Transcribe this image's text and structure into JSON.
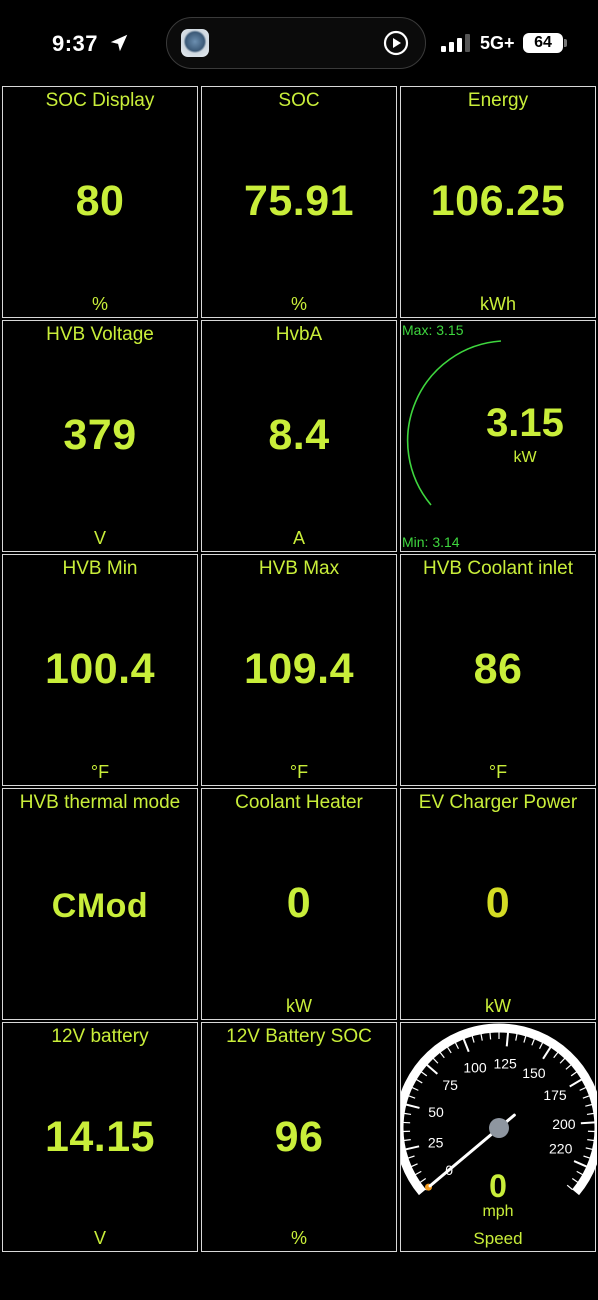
{
  "status": {
    "time": "9:37",
    "network": "5G+",
    "battery": "64"
  },
  "tiles": [
    {
      "title": "SOC Display",
      "value": "80",
      "unit": "%"
    },
    {
      "title": "SOC",
      "value": "75.91",
      "unit": "%"
    },
    {
      "title": "Energy",
      "value": "106.25",
      "unit": "kWh"
    },
    {
      "title": "HVB Voltage",
      "value": "379",
      "unit": "V"
    },
    {
      "title": "HvbA",
      "value": "8.4",
      "unit": "A"
    },
    {
      "title": "HVB Min",
      "value": "100.4",
      "unit": "°F"
    },
    {
      "title": "HVB Max",
      "value": "109.4",
      "unit": "°F"
    },
    {
      "title": "HVB Coolant inlet",
      "value": "86",
      "unit": "°F"
    },
    {
      "title": "HVB thermal mode",
      "value": "CMod",
      "unit": ""
    },
    {
      "title": "Coolant Heater",
      "value": "0",
      "unit": "kW"
    },
    {
      "title": "EV Charger Power",
      "value": "0",
      "unit": "kW"
    },
    {
      "title": "12V battery",
      "value": "14.15",
      "unit": "V"
    },
    {
      "title": "12V Battery SOC",
      "value": "96",
      "unit": "%"
    }
  ],
  "power_gauge": {
    "max_label": "Max: 3.15",
    "min_label": "Min: 3.14",
    "value": "3.15",
    "unit": "kW"
  },
  "speedometer": {
    "title": "Speed",
    "value": "0",
    "unit": "mph",
    "scale_labels": [
      "0",
      "25",
      "50",
      "75",
      "100",
      "125",
      "150",
      "175",
      "200",
      "220"
    ]
  },
  "colors": {
    "accent": "#c9ee3a",
    "gauge_green": "#3ed63e",
    "border": "#d8d8d8"
  }
}
